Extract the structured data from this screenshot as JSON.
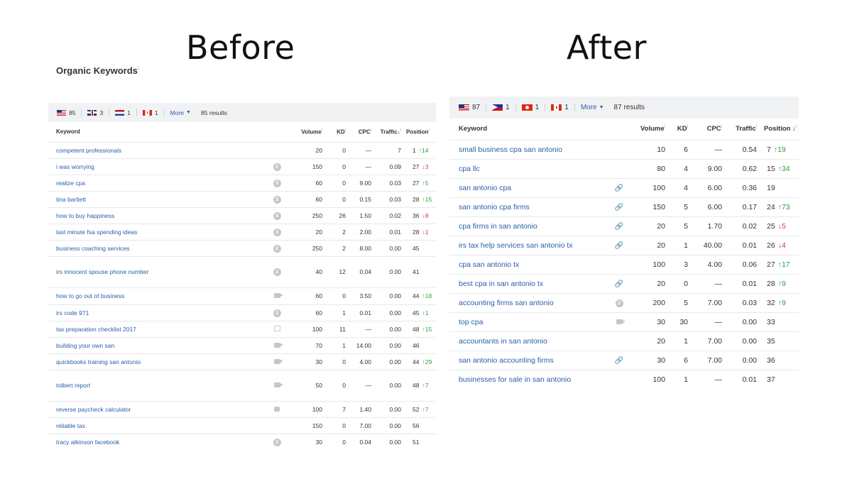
{
  "titles": {
    "before": "Before",
    "after": "After"
  },
  "before": {
    "section_title": "Organic Keywords",
    "info_mark": "i",
    "flags": [
      {
        "icon": "us-flag-icon",
        "count": "85"
      },
      {
        "icon": "gb-flag-icon",
        "count": "3"
      },
      {
        "icon": "nl-flag-icon",
        "count": "1"
      },
      {
        "icon": "ca-flag-icon",
        "count": "1"
      }
    ],
    "more_label": "More",
    "results_label": "85 results",
    "columns": {
      "keyword": "Keyword",
      "volume": "Volume",
      "kd": "KD",
      "cpc": "CPC",
      "traffic": "Traffic",
      "position": "Position"
    },
    "rows": [
      {
        "keyword": "competent professionals",
        "icon": "",
        "icon_label": "",
        "volume": "20",
        "kd": "0",
        "cpc": "—",
        "traffic": "7",
        "position": "1",
        "delta": "↑14",
        "delta_dir": "up",
        "h": 23
      },
      {
        "keyword": "i was worrying",
        "icon": "circle",
        "icon_label": "2",
        "volume": "150",
        "kd": "0",
        "cpc": "—",
        "traffic": "0.09",
        "position": "27",
        "delta": "↓3",
        "delta_dir": "down",
        "h": 23
      },
      {
        "keyword": "realize cpa",
        "icon": "circle",
        "icon_label": "3",
        "volume": "60",
        "kd": "0",
        "cpc": "9.00",
        "traffic": "0.03",
        "position": "27",
        "delta": "↑5",
        "delta_dir": "up",
        "h": 23
      },
      {
        "keyword": "tina bartlett",
        "icon": "circle",
        "icon_label": "3",
        "volume": "60",
        "kd": "0",
        "cpc": "0.15",
        "traffic": "0.03",
        "position": "28",
        "delta": "↑15",
        "delta_dir": "up",
        "h": 23
      },
      {
        "keyword": "how to buy happiness",
        "icon": "circle",
        "icon_label": "3",
        "volume": "250",
        "kd": "26",
        "cpc": "1.50",
        "traffic": "0.02",
        "position": "36",
        "delta": "↓8",
        "delta_dir": "down",
        "h": 23
      },
      {
        "keyword": "last minute fsa spending ideas",
        "icon": "circle",
        "icon_label": "3",
        "volume": "20",
        "kd": "2",
        "cpc": "2.00",
        "traffic": "0.01",
        "position": "28",
        "delta": "↓1",
        "delta_dir": "down",
        "h": 23
      },
      {
        "keyword": "business coaching services",
        "icon": "circle",
        "icon_label": "2",
        "volume": "250",
        "kd": "2",
        "cpc": "8.00",
        "traffic": "0.00",
        "position": "45",
        "delta": "",
        "delta_dir": "",
        "h": 23
      },
      {
        "keyword": "irs innocent spouse phone number",
        "icon": "circle",
        "icon_label": "2",
        "volume": "40",
        "kd": "12",
        "cpc": "0.04",
        "traffic": "0.00",
        "position": "41",
        "delta": "",
        "delta_dir": "",
        "h": 44
      },
      {
        "keyword": "how to go out of business",
        "icon": "video",
        "icon_label": "",
        "volume": "60",
        "kd": "0",
        "cpc": "3.50",
        "traffic": "0.00",
        "position": "44",
        "delta": "↑18",
        "delta_dir": "up",
        "h": 24
      },
      {
        "keyword": "irs code 971",
        "icon": "circle",
        "icon_label": "3",
        "volume": "60",
        "kd": "1",
        "cpc": "0.01",
        "traffic": "0.00",
        "position": "45",
        "delta": "↑1",
        "delta_dir": "up",
        "h": 23
      },
      {
        "keyword": "tax preparation checklist 2017",
        "icon": "image",
        "icon_label": "",
        "volume": "100",
        "kd": "11",
        "cpc": "—",
        "traffic": "0.00",
        "position": "48",
        "delta": "↑15",
        "delta_dir": "up",
        "h": 23
      },
      {
        "keyword": "building your own san",
        "icon": "video",
        "icon_label": "",
        "volume": "70",
        "kd": "1",
        "cpc": "14.00",
        "traffic": "0.00",
        "position": "46",
        "delta": "",
        "delta_dir": "",
        "h": 23
      },
      {
        "keyword": "quickbooks training san antonio",
        "icon": "video",
        "icon_label": "",
        "volume": "30",
        "kd": "0",
        "cpc": "4.00",
        "traffic": "0.00",
        "position": "44",
        "delta": "↑29",
        "delta_dir": "up",
        "h": 23
      },
      {
        "keyword": "tolbert report",
        "icon": "video",
        "icon_label": "",
        "volume": "50",
        "kd": "0",
        "cpc": "—",
        "traffic": "0.00",
        "position": "48",
        "delta": "↑7",
        "delta_dir": "up",
        "h": 44
      },
      {
        "keyword": "reverse paycheck calculator",
        "icon": "chat",
        "icon_label": "",
        "volume": "100",
        "kd": "7",
        "cpc": "1.40",
        "traffic": "0.00",
        "position": "52",
        "delta": "↑7",
        "delta_dir": "up",
        "h": 23
      },
      {
        "keyword": "reliable tax",
        "icon": "",
        "icon_label": "",
        "volume": "150",
        "kd": "0",
        "cpc": "7.00",
        "traffic": "0.00",
        "position": "56",
        "delta": "",
        "delta_dir": "",
        "h": 23
      },
      {
        "keyword": "tracy atkinson facebook",
        "icon": "circle",
        "icon_label": "2",
        "volume": "30",
        "kd": "0",
        "cpc": "0.04",
        "traffic": "0.00",
        "position": "51",
        "delta": "",
        "delta_dir": "",
        "h": 23
      }
    ]
  },
  "after": {
    "info_mark": "i",
    "flags": [
      {
        "icon": "us-flag-icon",
        "count": "87"
      },
      {
        "icon": "ph-flag-icon",
        "count": "1"
      },
      {
        "icon": "hk-flag-icon",
        "count": "1"
      },
      {
        "icon": "ca-flag-icon",
        "count": "1"
      }
    ],
    "more_label": "More",
    "results_label": "87 results",
    "columns": {
      "keyword": "Keyword",
      "volume": "Volume",
      "kd": "KD",
      "cpc": "CPC",
      "traffic": "Traffic",
      "position": "Position"
    },
    "rows": [
      {
        "keyword": "small business cpa san antonio",
        "icon": "",
        "icon_label": "",
        "volume": "10",
        "kd": "6",
        "cpc": "—",
        "traffic": "0.54",
        "position": "7",
        "delta": "↑19",
        "delta_dir": "up"
      },
      {
        "keyword": "cpa llc",
        "icon": "",
        "icon_label": "",
        "volume": "80",
        "kd": "4",
        "cpc": "9.00",
        "traffic": "0.62",
        "position": "15",
        "delta": "↑34",
        "delta_dir": "up"
      },
      {
        "keyword": "san antonio cpa",
        "icon": "link",
        "icon_label": "",
        "volume": "100",
        "kd": "4",
        "cpc": "6.00",
        "traffic": "0.36",
        "position": "19",
        "delta": "",
        "delta_dir": ""
      },
      {
        "keyword": "san antonio cpa firms",
        "icon": "link",
        "icon_label": "",
        "volume": "150",
        "kd": "5",
        "cpc": "6.00",
        "traffic": "0.17",
        "position": "24",
        "delta": "↑73",
        "delta_dir": "up"
      },
      {
        "keyword": "cpa firms in san antonio",
        "icon": "link",
        "icon_label": "",
        "volume": "20",
        "kd": "5",
        "cpc": "1.70",
        "traffic": "0.02",
        "position": "25",
        "delta": "↓5",
        "delta_dir": "down"
      },
      {
        "keyword": "irs tax help services san antonio tx",
        "icon": "link",
        "icon_label": "",
        "volume": "20",
        "kd": "1",
        "cpc": "40.00",
        "traffic": "0.01",
        "position": "26",
        "delta": "↓4",
        "delta_dir": "down"
      },
      {
        "keyword": "cpa san antonio tx",
        "icon": "",
        "icon_label": "",
        "volume": "100",
        "kd": "3",
        "cpc": "4.00",
        "traffic": "0.06",
        "position": "27",
        "delta": "↑17",
        "delta_dir": "up"
      },
      {
        "keyword": "best cpa in san antonio tx",
        "icon": "link",
        "icon_label": "",
        "volume": "20",
        "kd": "0",
        "cpc": "—",
        "traffic": "0.01",
        "position": "28",
        "delta": "↑9",
        "delta_dir": "up"
      },
      {
        "keyword": "accounting firms san antonio",
        "icon": "circle",
        "icon_label": "3",
        "volume": "200",
        "kd": "5",
        "cpc": "7.00",
        "traffic": "0.03",
        "position": "32",
        "delta": "↑9",
        "delta_dir": "up"
      },
      {
        "keyword": "top cpa",
        "icon": "video",
        "icon_label": "",
        "volume": "30",
        "kd": "30",
        "cpc": "—",
        "traffic": "0.00",
        "position": "33",
        "delta": "",
        "delta_dir": ""
      },
      {
        "keyword": "accountants in san antonio",
        "icon": "",
        "icon_label": "",
        "volume": "20",
        "kd": "1",
        "cpc": "7.00",
        "traffic": "0.00",
        "position": "35",
        "delta": "",
        "delta_dir": ""
      },
      {
        "keyword": "san antonio accounting firms",
        "icon": "link",
        "icon_label": "",
        "volume": "30",
        "kd": "6",
        "cpc": "7.00",
        "traffic": "0.00",
        "position": "36",
        "delta": "",
        "delta_dir": ""
      },
      {
        "keyword": "businesses for sale in san antonio",
        "icon": "",
        "icon_label": "",
        "volume": "100",
        "kd": "1",
        "cpc": "—",
        "traffic": "0.01",
        "position": "37",
        "delta": "",
        "delta_dir": ""
      }
    ]
  }
}
